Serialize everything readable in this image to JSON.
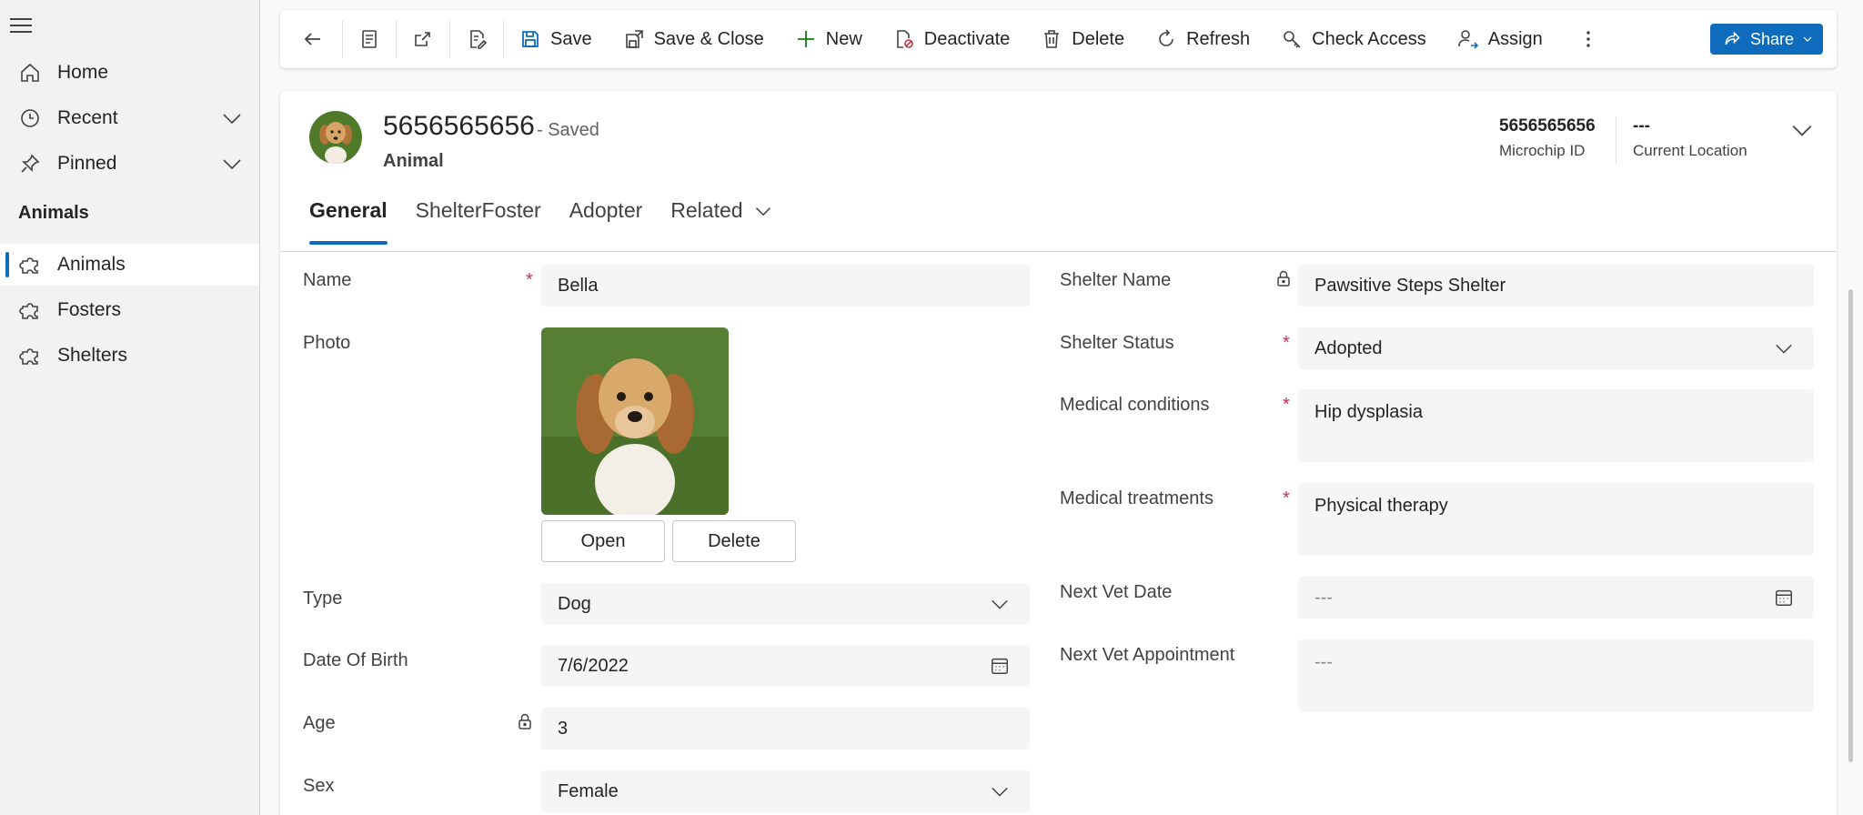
{
  "nav": {
    "items": [
      {
        "label": "Home"
      },
      {
        "label": "Recent"
      },
      {
        "label": "Pinned"
      }
    ],
    "section_title": "Animals",
    "section_items": [
      {
        "label": "Animals"
      },
      {
        "label": "Fosters"
      },
      {
        "label": "Shelters"
      }
    ]
  },
  "toolbar": {
    "save": "Save",
    "save_close": "Save & Close",
    "new": "New",
    "deactivate": "Deactivate",
    "delete": "Delete",
    "refresh": "Refresh",
    "check_access": "Check Access",
    "assign": "Assign",
    "share": "Share"
  },
  "record": {
    "title": "5656565656",
    "status": "- Saved",
    "entity": "Animal",
    "header_fields": [
      {
        "value": "5656565656",
        "label": "Microchip ID"
      },
      {
        "value": "---",
        "label": "Current Location"
      }
    ]
  },
  "tabs": [
    "General",
    "ShelterFoster",
    "Adopter",
    "Related"
  ],
  "form": {
    "left": {
      "name": {
        "label": "Name",
        "value": "Bella"
      },
      "photo": {
        "label": "Photo",
        "open": "Open",
        "delete": "Delete"
      },
      "type": {
        "label": "Type",
        "value": "Dog"
      },
      "dob": {
        "label": "Date Of Birth",
        "value": "7/6/2022"
      },
      "age": {
        "label": "Age",
        "value": "3"
      },
      "sex": {
        "label": "Sex",
        "value": "Female"
      }
    },
    "right": {
      "shelter_name": {
        "label": "Shelter Name",
        "value": "Pawsitive Steps Shelter"
      },
      "shelter_status": {
        "label": "Shelter Status",
        "value": "Adopted"
      },
      "medical_conditions": {
        "label": "Medical conditions",
        "value": "Hip dysplasia"
      },
      "medical_treatments": {
        "label": "Medical treatments",
        "value": "Physical therapy"
      },
      "next_vet_date": {
        "label": "Next Vet Date",
        "value": "---"
      },
      "next_vet_appointment": {
        "label": "Next Vet Appointment",
        "value": "---"
      }
    },
    "required_mark": "*"
  },
  "colors": {
    "accent": "#0f6cbd",
    "required": "#c4314b"
  }
}
